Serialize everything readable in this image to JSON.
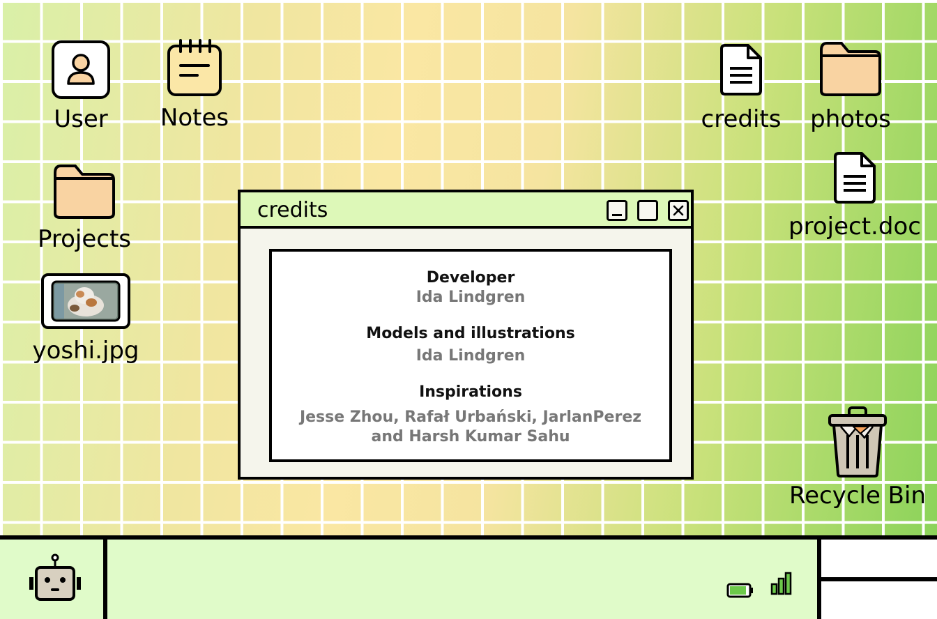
{
  "desktop": {
    "icons": [
      {
        "label": "User",
        "icon": "user-icon"
      },
      {
        "label": "Notes",
        "icon": "notes-icon"
      },
      {
        "label": "Projects",
        "icon": "folder-icon"
      },
      {
        "label": "yoshi.jpg",
        "icon": "image-icon"
      },
      {
        "label": "credits",
        "icon": "document-icon"
      },
      {
        "label": "photos",
        "icon": "folder-icon"
      },
      {
        "label": "project.doc",
        "icon": "document-icon"
      },
      {
        "label": "Recycle Bin",
        "icon": "trash-icon"
      }
    ]
  },
  "window": {
    "title": "credits",
    "sections": [
      {
        "heading": "Developer",
        "lines": [
          "Ida Lindgren"
        ]
      },
      {
        "heading": "Models and illustrations",
        "lines": [
          "Ida Lindgren"
        ]
      },
      {
        "heading": "Inspirations",
        "lines": [
          "Jesse Zhou, Rafał Urbański, JarlanPerez",
          "and Harsh Kumar Sahu"
        ]
      }
    ]
  },
  "taskbar": {
    "start_icon": "robot-icon",
    "battery_level": 0.9,
    "signal_bars": 3
  },
  "colors": {
    "folder": "#f9d3a2",
    "notes": "#fbe7a7",
    "titlebar": "#ddf8b8",
    "taskbar": "#e0fbc9",
    "battery_fill": "#6cc94a"
  }
}
